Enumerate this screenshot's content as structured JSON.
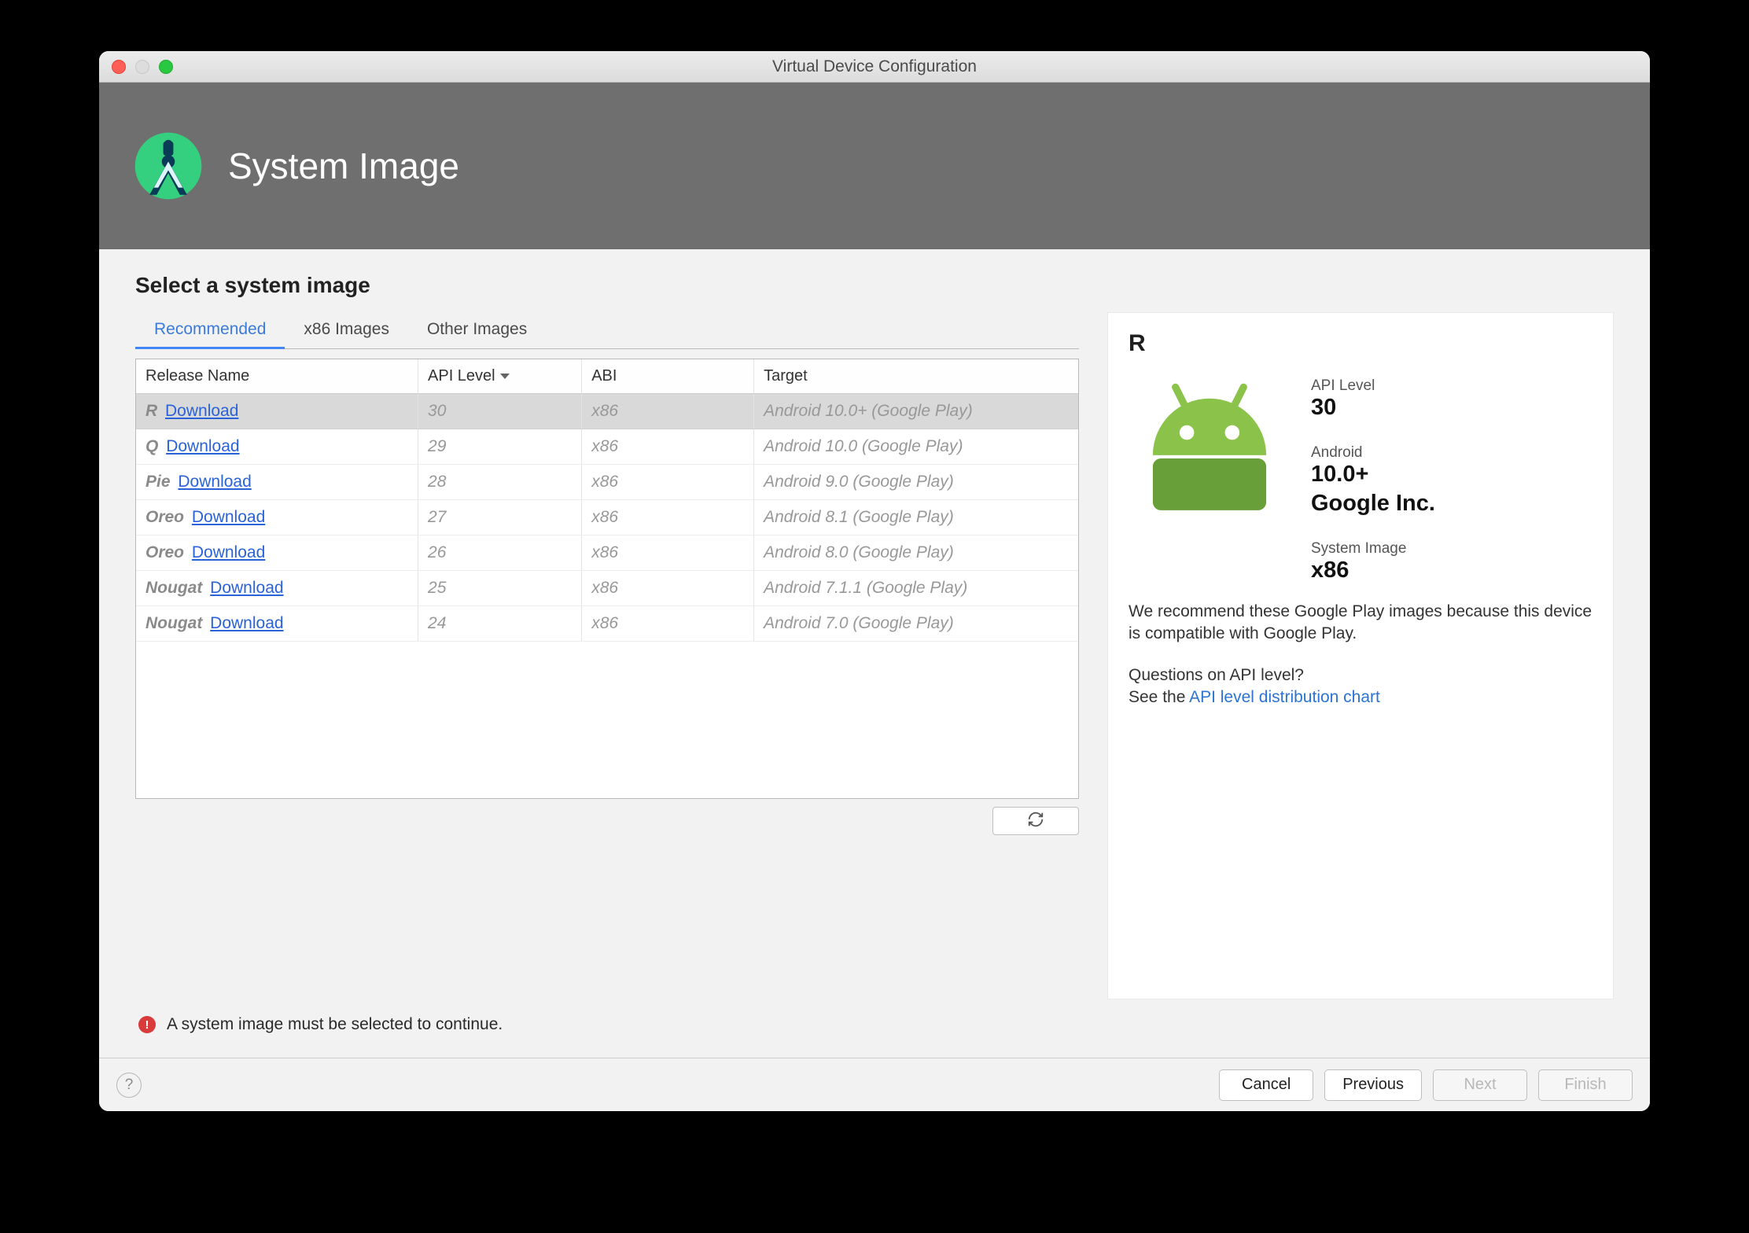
{
  "window": {
    "title": "Virtual Device Configuration"
  },
  "hero": {
    "title": "System Image"
  },
  "subheader": "Select a system image",
  "tabs": {
    "recommended": "Recommended",
    "x86": "x86 Images",
    "other": "Other Images"
  },
  "columns": {
    "release": "Release Name",
    "api": "API Level",
    "abi": "ABI",
    "target": "Target"
  },
  "download_label": "Download",
  "rows": [
    {
      "name": "R",
      "api": "30",
      "abi": "x86",
      "target": "Android 10.0+ (Google Play)",
      "selected": true
    },
    {
      "name": "Q",
      "api": "29",
      "abi": "x86",
      "target": "Android 10.0 (Google Play)",
      "selected": false
    },
    {
      "name": "Pie",
      "api": "28",
      "abi": "x86",
      "target": "Android 9.0 (Google Play)",
      "selected": false
    },
    {
      "name": "Oreo",
      "api": "27",
      "abi": "x86",
      "target": "Android 8.1 (Google Play)",
      "selected": false
    },
    {
      "name": "Oreo",
      "api": "26",
      "abi": "x86",
      "target": "Android 8.0 (Google Play)",
      "selected": false
    },
    {
      "name": "Nougat",
      "api": "25",
      "abi": "x86",
      "target": "Android 7.1.1 (Google Play)",
      "selected": false
    },
    {
      "name": "Nougat",
      "api": "24",
      "abi": "x86",
      "target": "Android 7.0 (Google Play)",
      "selected": false
    }
  ],
  "panel": {
    "code": "R",
    "api_label": "API Level",
    "api_value": "30",
    "android_label": "Android",
    "android_value": "10.0+",
    "vendor": "Google Inc.",
    "sysimg_label": "System Image",
    "sysimg_value": "x86",
    "recommend_text": "We recommend these Google Play images because this device is compatible with Google Play.",
    "question": "Questions on API level?",
    "see_the": "See the ",
    "link_text": "API level distribution chart"
  },
  "alert": "A system image must be selected to continue.",
  "footer": {
    "cancel": "Cancel",
    "previous": "Previous",
    "next": "Next",
    "finish": "Finish"
  }
}
